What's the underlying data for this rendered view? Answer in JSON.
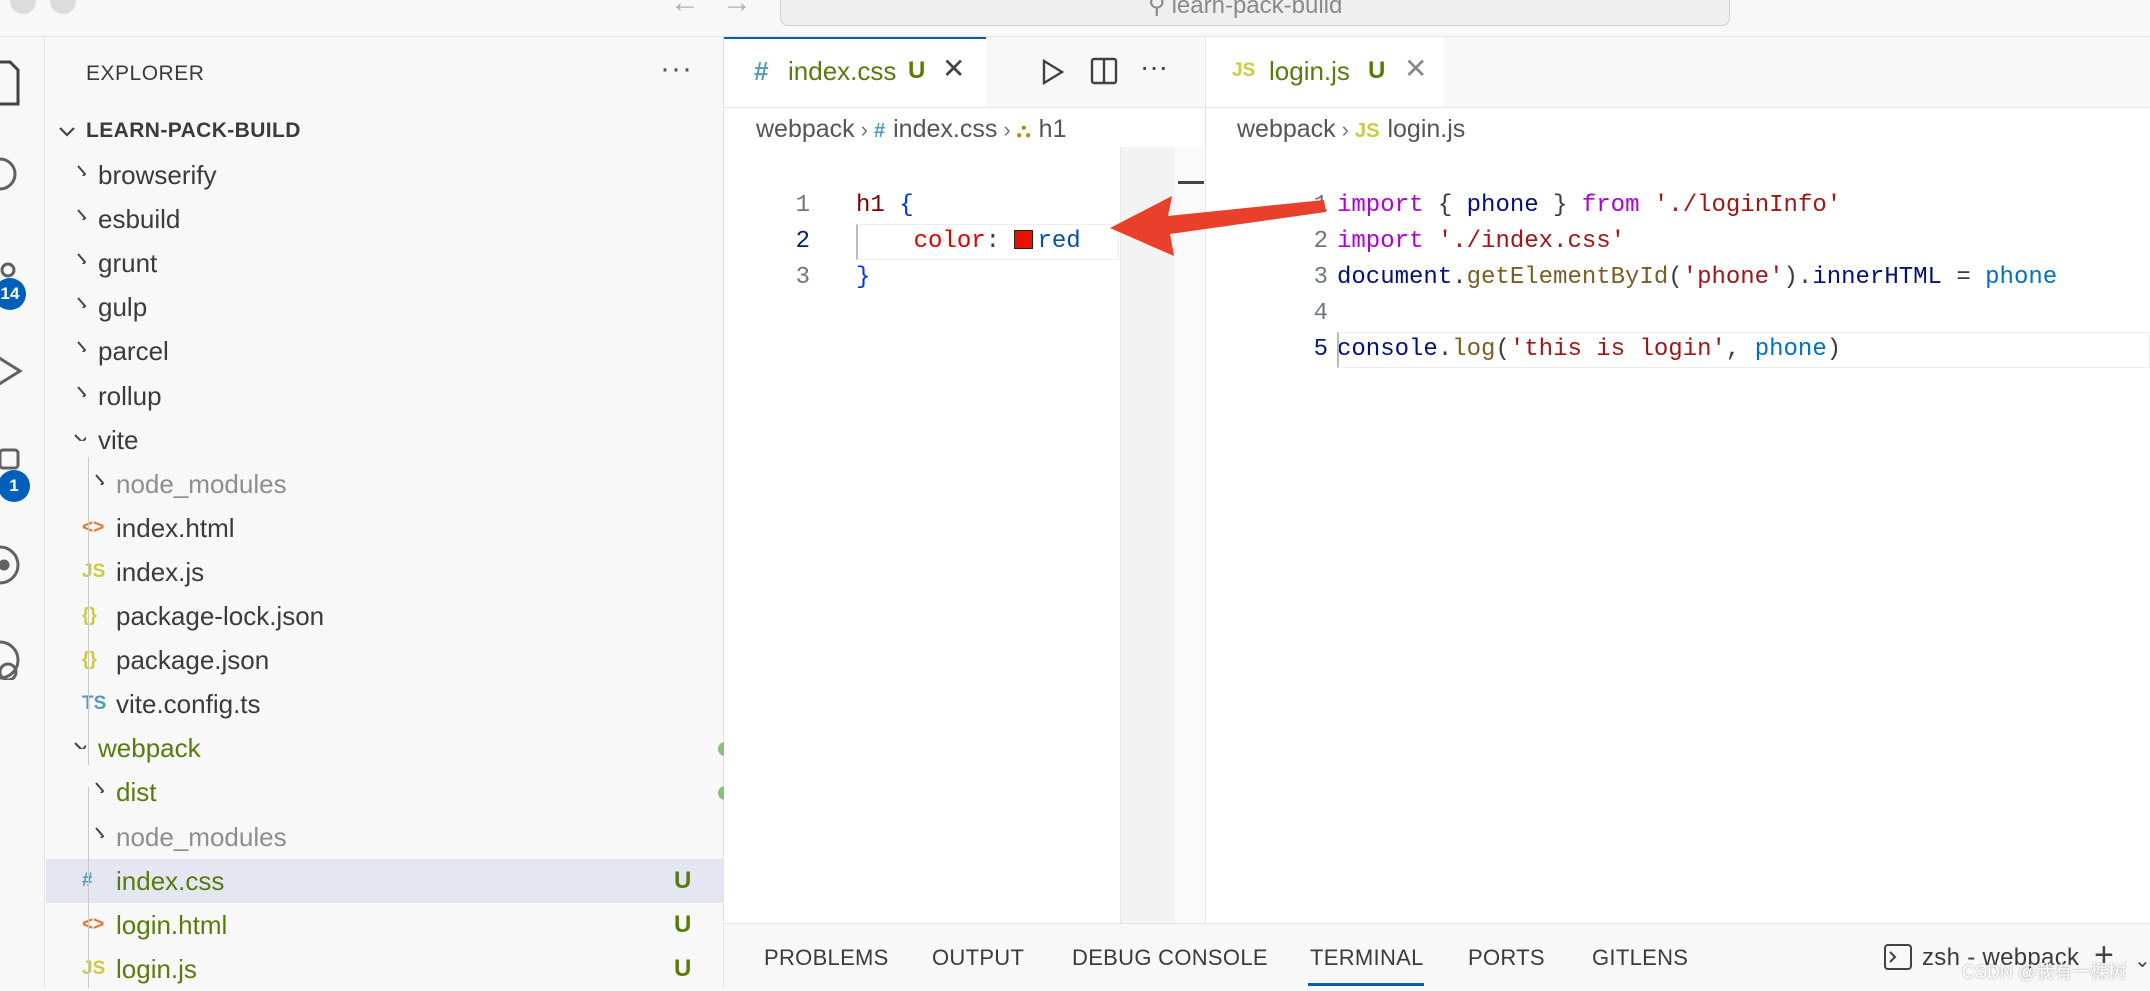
{
  "window": {
    "search_text": "learn-pack-build"
  },
  "activity_bar": {
    "items": [
      {
        "name": "explorer",
        "badge": ""
      },
      {
        "name": "search",
        "badge": ""
      },
      {
        "name": "source-control",
        "badge": "14"
      },
      {
        "name": "run-debug",
        "badge": ""
      },
      {
        "name": "extensions",
        "badge": "1"
      },
      {
        "name": "remote",
        "badge": ""
      },
      {
        "name": "gitlens",
        "badge": ""
      }
    ]
  },
  "sidebar": {
    "title": "EXPLORER",
    "more": "···",
    "root": "LEARN-PACK-BUILD",
    "items": [
      {
        "label": "browserify",
        "type": "folder",
        "expanded": false,
        "indent": 1,
        "icon": "",
        "status": "",
        "color": "#3b3b3b"
      },
      {
        "label": "esbuild",
        "type": "folder",
        "expanded": false,
        "indent": 1,
        "icon": "",
        "status": "",
        "color": "#3b3b3b"
      },
      {
        "label": "grunt",
        "type": "folder",
        "expanded": false,
        "indent": 1,
        "icon": "",
        "status": "",
        "color": "#3b3b3b"
      },
      {
        "label": "gulp",
        "type": "folder",
        "expanded": false,
        "indent": 1,
        "icon": "",
        "status": "",
        "color": "#3b3b3b"
      },
      {
        "label": "parcel",
        "type": "folder",
        "expanded": false,
        "indent": 1,
        "icon": "",
        "status": "",
        "color": "#3b3b3b"
      },
      {
        "label": "rollup",
        "type": "folder",
        "expanded": false,
        "indent": 1,
        "icon": "",
        "status": "",
        "color": "#3b3b3b"
      },
      {
        "label": "vite",
        "type": "folder",
        "expanded": true,
        "indent": 1,
        "icon": "",
        "status": "",
        "color": "#3b3b3b"
      },
      {
        "label": "node_modules",
        "type": "folder",
        "expanded": false,
        "indent": 2,
        "icon": "",
        "status": "",
        "color": "#8e8e8e"
      },
      {
        "label": "index.html",
        "type": "file",
        "indent": 2,
        "icon": "<>",
        "iconColor": "#e37933",
        "status": "",
        "color": "#3b3b3b"
      },
      {
        "label": "index.js",
        "type": "file",
        "indent": 2,
        "icon": "JS",
        "iconColor": "#cbcb41",
        "status": "",
        "color": "#3b3b3b"
      },
      {
        "label": "package-lock.json",
        "type": "file",
        "indent": 2,
        "icon": "{}",
        "iconColor": "#cbcb41",
        "status": "",
        "color": "#3b3b3b"
      },
      {
        "label": "package.json",
        "type": "file",
        "indent": 2,
        "icon": "{}",
        "iconColor": "#cbcb41",
        "status": "",
        "color": "#3b3b3b"
      },
      {
        "label": "vite.config.ts",
        "type": "file",
        "indent": 2,
        "icon": "TS",
        "iconColor": "#519aba",
        "status": "",
        "color": "#3b3b3b"
      },
      {
        "label": "webpack",
        "type": "folder",
        "expanded": true,
        "indent": 1,
        "icon": "",
        "status": "dot",
        "color": "#587c0c"
      },
      {
        "label": "dist",
        "type": "folder",
        "expanded": false,
        "indent": 2,
        "icon": "",
        "status": "dot",
        "color": "#587c0c"
      },
      {
        "label": "node_modules",
        "type": "folder",
        "expanded": false,
        "indent": 2,
        "icon": "",
        "status": "",
        "color": "#8e8e8e"
      },
      {
        "label": "index.css",
        "type": "file",
        "indent": 2,
        "icon": "#",
        "iconColor": "#519aba",
        "status": "U",
        "color": "#587c0c",
        "selected": true
      },
      {
        "label": "login.html",
        "type": "file",
        "indent": 2,
        "icon": "<>",
        "iconColor": "#e37933",
        "status": "U",
        "color": "#587c0c"
      },
      {
        "label": "login.js",
        "type": "file",
        "indent": 2,
        "icon": "JS",
        "iconColor": "#cbcb41",
        "status": "U",
        "color": "#587c0c"
      }
    ]
  },
  "editor_left": {
    "tab": {
      "icon": "#",
      "label": "index.css",
      "status": "U",
      "close": "✕"
    },
    "breadcrumb": [
      "webpack",
      "index.css",
      "h1"
    ],
    "lines": [
      {
        "num": "1",
        "tokens": [
          {
            "t": "h1 ",
            "c": "sel"
          },
          {
            "t": "{",
            "c": "brace"
          }
        ]
      },
      {
        "num": "2",
        "tokens": [
          {
            "t": "    color",
            "c": "prop"
          },
          {
            "t": ": ",
            "c": "plain"
          },
          {
            "t": "red",
            "c": "val"
          }
        ]
      },
      {
        "num": "3",
        "tokens": [
          {
            "t": "}",
            "c": "brace"
          }
        ]
      }
    ],
    "active_line": 2,
    "swatch_color": "#e51400"
  },
  "editor_right": {
    "tab": {
      "icon": "JS",
      "label": "login.js",
      "status": "U",
      "close": "✕"
    },
    "breadcrumb": [
      "webpack",
      "login.js"
    ],
    "lines": [
      {
        "num": "1",
        "tokens": [
          {
            "t": "import",
            "c": "kw"
          },
          {
            "t": " { ",
            "c": "plain"
          },
          {
            "t": "phone",
            "c": "var"
          },
          {
            "t": " } ",
            "c": "plain"
          },
          {
            "t": "from",
            "c": "kw"
          },
          {
            "t": " ",
            "c": "plain"
          },
          {
            "t": "'./loginInfo'",
            "c": "str"
          }
        ]
      },
      {
        "num": "2",
        "tokens": [
          {
            "t": "import",
            "c": "kw"
          },
          {
            "t": " ",
            "c": "plain"
          },
          {
            "t": "'./index.css'",
            "c": "str"
          }
        ]
      },
      {
        "num": "3",
        "tokens": [
          {
            "t": "document",
            "c": "var"
          },
          {
            "t": ".",
            "c": "plain"
          },
          {
            "t": "getElementById",
            "c": "vfn"
          },
          {
            "t": "(",
            "c": "plain"
          },
          {
            "t": "'phone'",
            "c": "str"
          },
          {
            "t": ").",
            "c": "plain"
          },
          {
            "t": "innerHTML",
            "c": "var"
          },
          {
            "t": " = ",
            "c": "plain"
          },
          {
            "t": "phone",
            "c": "pl"
          }
        ]
      },
      {
        "num": "4",
        "tokens": []
      },
      {
        "num": "5",
        "tokens": [
          {
            "t": "console",
            "c": "var"
          },
          {
            "t": ".",
            "c": "plain"
          },
          {
            "t": "log",
            "c": "vfn"
          },
          {
            "t": "(",
            "c": "plain"
          },
          {
            "t": "'this is login'",
            "c": "str"
          },
          {
            "t": ", ",
            "c": "plain"
          },
          {
            "t": "phone",
            "c": "pl"
          },
          {
            "t": ")",
            "c": "plain"
          }
        ]
      }
    ],
    "active_line": 5
  },
  "panel": {
    "tabs": [
      "PROBLEMS",
      "OUTPUT",
      "DEBUG CONSOLE",
      "TERMINAL",
      "PORTS",
      "GITLENS"
    ],
    "active": "TERMINAL",
    "terminal_label": "zsh - webpack"
  },
  "watermark": "CSDN @我有一棵树",
  "colors": {
    "accent": "#005fb8",
    "arrow": "#e8402a",
    "git_untracked": "#587c0c"
  }
}
